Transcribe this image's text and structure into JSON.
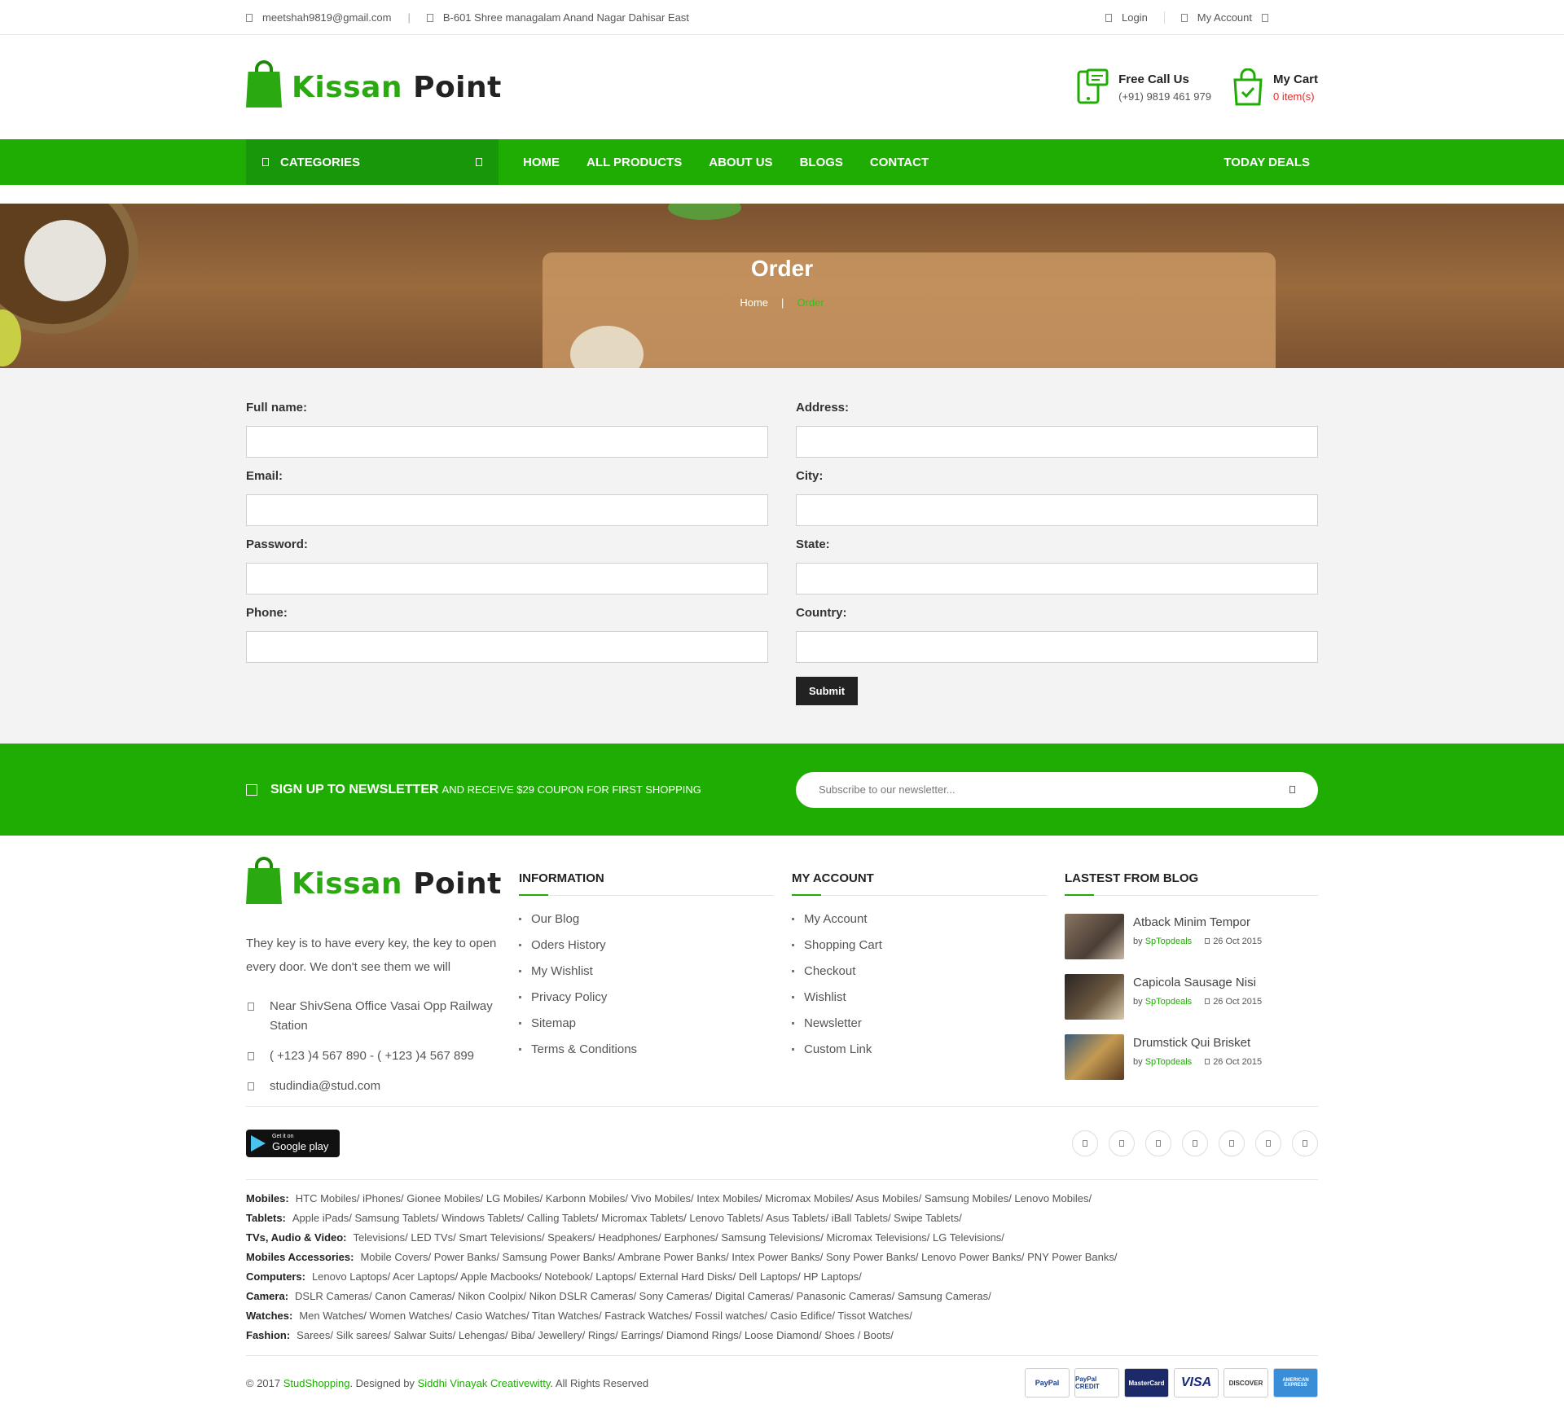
{
  "topbar": {
    "email": "meetshah9819@gmail.com",
    "address": "B-601 Shree managalam Anand Nagar Dahisar East",
    "login": "Login",
    "my_account": "My Account"
  },
  "header": {
    "logo_part1": "Kissan",
    "logo_part2": "Point",
    "call_title": "Free Call Us",
    "call_number": "(+91) 9819 461 979",
    "cart_title": "My Cart",
    "cart_count": "0 item(s)"
  },
  "nav": {
    "categories": "CATEGORIES",
    "items": [
      "HOME",
      "ALL PRODUCTS",
      "ABOUT US",
      "BLOGS",
      "CONTACT"
    ],
    "deals": "TODAY DEALS"
  },
  "banner": {
    "title": "Order",
    "crumb_home": "Home",
    "crumb_current": "Order"
  },
  "form": {
    "left": [
      {
        "label": "Full name:",
        "value": ""
      },
      {
        "label": "Email:",
        "value": ""
      },
      {
        "label": "Password:",
        "value": ""
      },
      {
        "label": "Phone:",
        "value": ""
      }
    ],
    "right": [
      {
        "label": "Address:",
        "value": ""
      },
      {
        "label": "City:",
        "value": ""
      },
      {
        "label": "State:",
        "value": ""
      },
      {
        "label": "Country:",
        "value": ""
      }
    ],
    "submit": "Submit"
  },
  "newsletter": {
    "title": "SIGN UP TO NEWSLETTER",
    "text": "AND RECEIVE $29 COUPON FOR FIRST SHOPPING",
    "placeholder": "Subscribe to our newsletter..."
  },
  "footer": {
    "about": "They key is to have every key, the key to open every door. We don't see them we will",
    "address": "Near ShivSena Office Vasai Opp Railway Station",
    "phone": "( +123 )4 567 890 - ( +123 )4 567 899",
    "email": "studindia@stud.com",
    "info_title": "INFORMATION",
    "info_links": [
      "Our Blog",
      "Oders History",
      "My Wishlist",
      "Privacy Policy",
      "Sitemap",
      "Terms & Conditions"
    ],
    "account_title": "MY ACCOUNT",
    "account_links": [
      "My Account",
      "Shopping Cart",
      "Checkout",
      "Wishlist",
      "Newsletter",
      "Custom Link"
    ],
    "blog_title": "LASTEST FROM BLOG",
    "blog_posts": [
      {
        "title": "Atback Minim Tempor",
        "by": "by",
        "author": "SpTopdeals",
        "date": "26 Oct 2015"
      },
      {
        "title": "Capicola Sausage Nisi",
        "by": "by",
        "author": "SpTopdeals",
        "date": "26 Oct 2015"
      },
      {
        "title": "Drumstick Qui Brisket",
        "by": "by",
        "author": "SpTopdeals",
        "date": "26 Oct 2015"
      }
    ],
    "gplay_small": "Get it on",
    "gplay_big": "Google play",
    "tags": [
      {
        "label": "Mobiles:",
        "items": "HTC Mobiles/ iPhones/ Gionee Mobiles/ LG Mobiles/ Karbonn Mobiles/ Vivo Mobiles/ Intex Mobiles/ Micromax Mobiles/ Asus Mobiles/ Samsung Mobiles/ Lenovo Mobiles/"
      },
      {
        "label": "Tablets:",
        "items": "Apple iPads/ Samsung Tablets/ Windows Tablets/ Calling Tablets/ Micromax Tablets/ Lenovo Tablets/ Asus Tablets/ iBall Tablets/ Swipe Tablets/"
      },
      {
        "label": "TVs, Audio & Video:",
        "items": "Televisions/ LED TVs/ Smart Televisions/ Speakers/ Headphones/ Earphones/ Samsung Televisions/ Micromax Televisions/ LG Televisions/"
      },
      {
        "label": "Mobiles Accessories:",
        "items": "Mobile Covers/ Power Banks/ Samsung Power Banks/ Ambrane Power Banks/ Intex Power Banks/ Sony Power Banks/ Lenovo Power Banks/ PNY Power Banks/"
      },
      {
        "label": "Computers:",
        "items": "Lenovo Laptops/ Acer Laptops/ Apple Macbooks/ Notebook/ Laptops/ External Hard Disks/ Dell Laptops/ HP Laptops/"
      },
      {
        "label": "Camera:",
        "items": "DSLR Cameras/ Canon Cameras/ Nikon Coolpix/ Nikon DSLR Cameras/ Sony Cameras/ Digital Cameras/ Panasonic Cameras/ Samsung Cameras/"
      },
      {
        "label": "Watches:",
        "items": "Men Watches/ Women Watches/ Casio Watches/ Titan Watches/ Fastrack Watches/ Fossil watches/ Casio Edifice/ Tissot Watches/"
      },
      {
        "label": "Fashion:",
        "items": "Sarees/ Silk sarees/ Salwar Suits/ Lehengas/ Biba/ Jewellery/ Rings/ Earrings/ Diamond Rings/ Loose Diamond/ Shoes / Boots/"
      }
    ],
    "copyright_pre": "© 2017",
    "copyright_brand": "StudShopping",
    "copyright_mid": ". Designed by",
    "copyright_designer": "Siddhi Vinayak Creativewitty",
    "copyright_post": ". All Rights Reserved",
    "payments": [
      "PayPal",
      "PayPal CREDIT",
      "MasterCard",
      "VISA",
      "DISCOVER",
      "AMERICAN EXPRESS"
    ]
  },
  "colors": {
    "brand_green": "#1fad04",
    "dark_green": "#18970a",
    "cart_red": "#e32b2b"
  }
}
